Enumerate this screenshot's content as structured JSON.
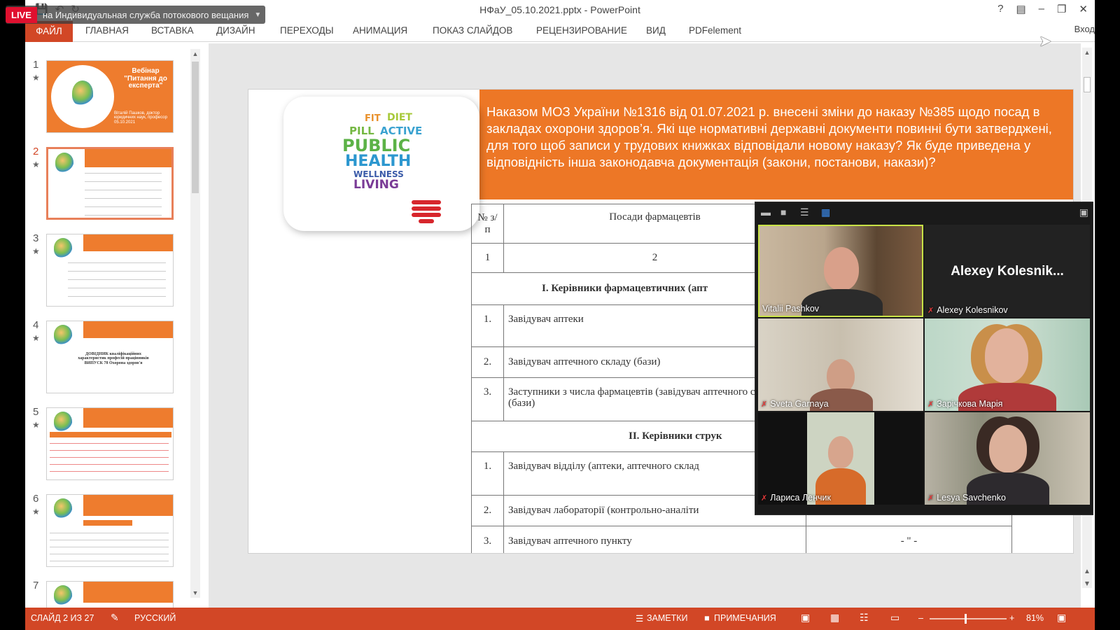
{
  "window": {
    "title": "НФаУ_05.10.2021.pptx - PowerPoint",
    "help": "?",
    "sign_in": "Вход"
  },
  "stream": {
    "live_badge": "LIVE",
    "service": "на Индивидуальная служба потокового вещания"
  },
  "ribbon": {
    "tabs": [
      "ФАЙЛ",
      "ГЛАВНАЯ",
      "ВСТАВКА",
      "ДИЗАЙН",
      "ПЕРЕХОДЫ",
      "АНИМАЦИЯ",
      "ПОКАЗ СЛАЙДОВ",
      "РЕЦЕНЗИРОВАНИЕ",
      "ВИД",
      "PDFelement"
    ]
  },
  "thumbnails": {
    "slide1_title": "Вебінар \"Питання до експерта\"",
    "slide1_author": "Віталій Пашков, доктор юридичних наук, професор 05.10.2021",
    "slide4_title": "ДОВІДНИК кваліфікаційних характеристик професій працівників ВИПУСК 78 Охорона здоров'я",
    "items": [
      {
        "num": "1"
      },
      {
        "num": "2"
      },
      {
        "num": "3"
      },
      {
        "num": "4"
      },
      {
        "num": "5"
      },
      {
        "num": "6"
      },
      {
        "num": "7"
      }
    ]
  },
  "slide": {
    "header": "Наказом МОЗ України №1316 від 01.07.2021 р. внесені зміни до наказу №385 щодо посад в закладах охорони здоров’я. Які ще нормативні державні документи повинні бути затверджені, для того щоб записи у трудових книжках відповідали новому наказу? Як буде приведена у відповідність інша законодавча документація (закони, постанови, накази)?",
    "logo_words": {
      "fit": "FIT",
      "diet": "DIET",
      "pill": "PILL",
      "active": "ACTIVE",
      "public": "PUBLIC",
      "health": "HEALTH",
      "wellness": "WELLNESS",
      "living": "LIVING"
    },
    "table": {
      "col_num": "№ з/п",
      "col_position": "Посади фармацевтів",
      "num_row": {
        "n1": "1",
        "n2": "2"
      },
      "section1": "І. Керівники фармацевтичних (апт",
      "rows1": [
        {
          "n": "1.",
          "text": "Завідувач аптеки"
        },
        {
          "n": "2.",
          "text": "Завідувач аптечного складу (бази)"
        },
        {
          "n": "3.",
          "text": "Заступники з числа фармацевтів (завідувач аптечного складу (бази)"
        }
      ],
      "section2": "ІІ. Керівники струк",
      "rows2": [
        {
          "n": "1.",
          "text": "Завідувач відділу (аптеки, аптечного склад"
        },
        {
          "n": "2.",
          "text": "Завідувач лабораторії (контрольно-аналіти"
        },
        {
          "n": "3.",
          "text": "Завідувач аптечного пункту",
          "extra": "- \" -"
        }
      ]
    }
  },
  "video_call": {
    "big_name_label": "Alexey  Kolesnik...",
    "participants": [
      {
        "name": "Vitalii Pashkov",
        "muted": false
      },
      {
        "name": "Alexey Kolesnikov",
        "muted": true
      },
      {
        "name": "Sveta Garnaya",
        "muted": true
      },
      {
        "name": "Зарічкова Марія",
        "muted": true
      },
      {
        "name": "Лариса Ленчик",
        "muted": true
      },
      {
        "name": "Lesya Savchenko",
        "muted": true
      }
    ]
  },
  "statusbar": {
    "slide_info": "СЛАЙД 2 ИЗ 27",
    "language": "РУССКИЙ",
    "notes": "ЗАМЕТКИ",
    "comments": "ПРИМЕЧАНИЯ",
    "zoom": "81%"
  }
}
